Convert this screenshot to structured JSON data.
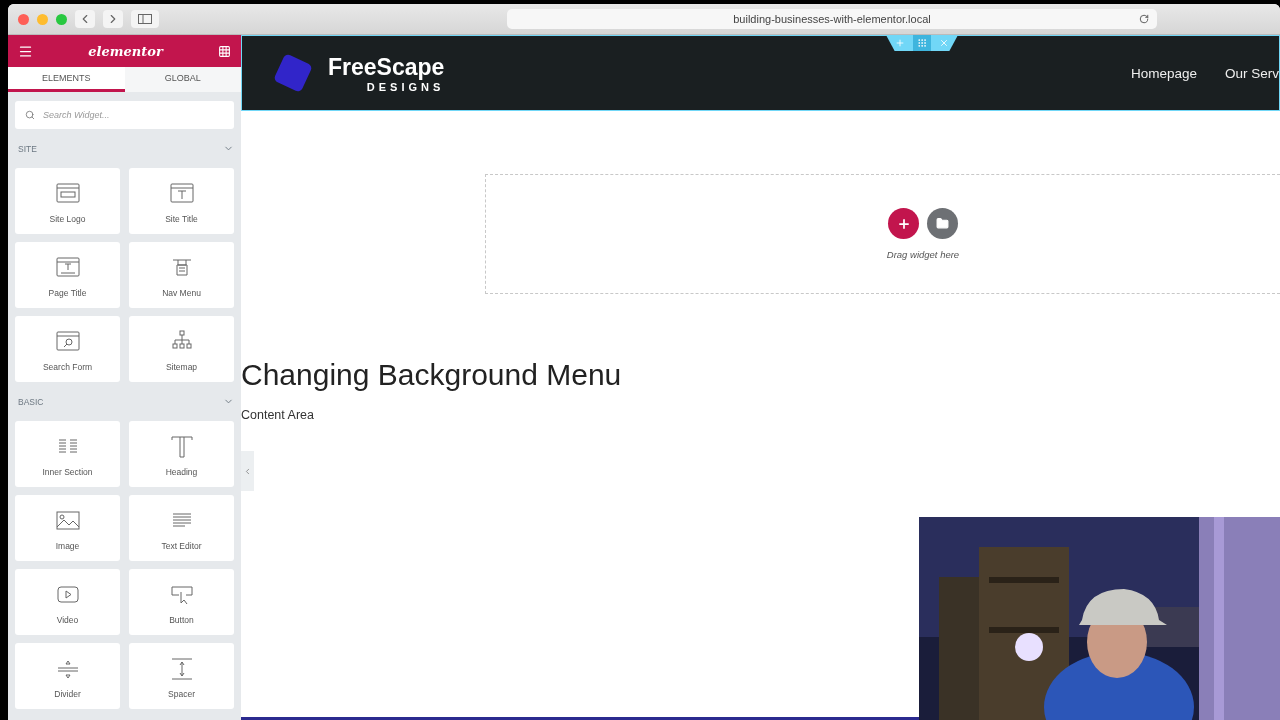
{
  "browser": {
    "url": "building-businesses-with-elementor.local"
  },
  "panel": {
    "brand": "elementor",
    "tabs": [
      {
        "label": "ELEMENTS",
        "selected": true
      },
      {
        "label": "GLOBAL",
        "selected": false
      }
    ],
    "search": {
      "placeholder": "Search Widget..."
    },
    "sections": [
      {
        "title": "SITE",
        "expanded": true,
        "widgets": [
          "Site Logo",
          "Site Title",
          "Page Title",
          "Nav Menu",
          "Search Form",
          "Sitemap"
        ]
      },
      {
        "title": "BASIC",
        "expanded": true,
        "widgets": [
          "Inner Section",
          "Heading",
          "Image",
          "Text Editor",
          "Video",
          "Button",
          "Divider",
          "Spacer"
        ]
      }
    ]
  },
  "site": {
    "logo": {
      "name": "FreeScape",
      "tagline": "DESIGNS"
    },
    "nav": [
      "Homepage",
      "Our Serv"
    ]
  },
  "dropzone": {
    "hint": "Drag widget here"
  },
  "content": {
    "heading": "Changing Background Menu",
    "text": "Content Area"
  }
}
